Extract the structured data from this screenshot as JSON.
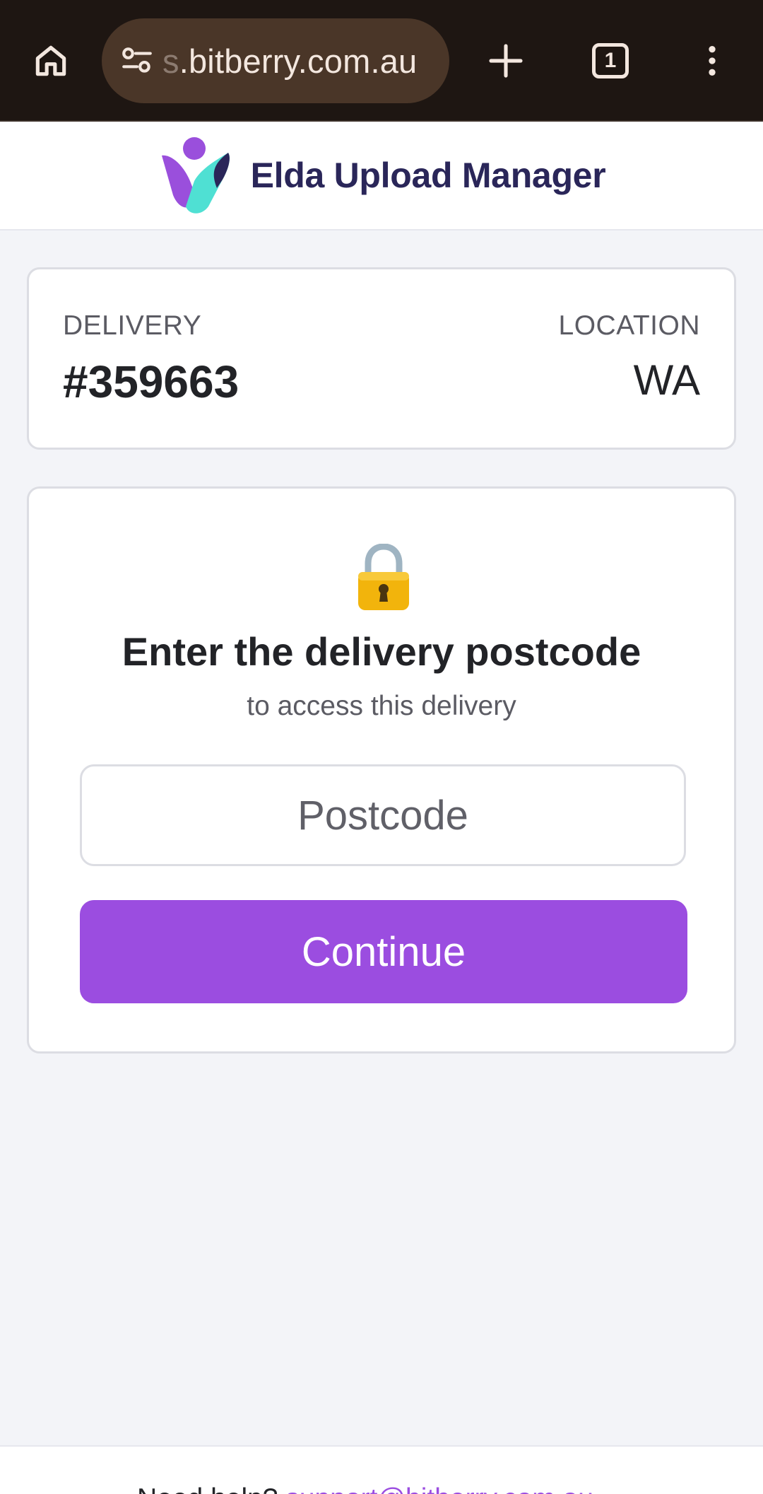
{
  "browser": {
    "url_faded": "s",
    "url_main": ".bitberry.com.au",
    "tab_count": "1",
    "icons": [
      "home-icon",
      "site-settings-icon",
      "plus-icon",
      "tabs-icon",
      "more-vert-icon"
    ]
  },
  "header": {
    "app_title": "Elda Upload Manager"
  },
  "delivery": {
    "delivery_label": "DELIVERY",
    "delivery_value": "#359663",
    "location_label": "LOCATION",
    "location_value": "WA"
  },
  "access": {
    "icon": "lock-icon",
    "title": "Enter the delivery postcode",
    "subtitle": "to access this delivery",
    "postcode_placeholder": "Postcode",
    "postcode_value": "",
    "continue_label": "Continue"
  },
  "footer": {
    "text": "Need help? ",
    "link": "support@bitberry.com.au"
  },
  "colors": {
    "browser_bar": "#1e1612",
    "url_pill": "#4a3628",
    "brand_dark": "#2a2659",
    "accent": "#9b4de0",
    "page_bg": "#f3f4f8"
  }
}
